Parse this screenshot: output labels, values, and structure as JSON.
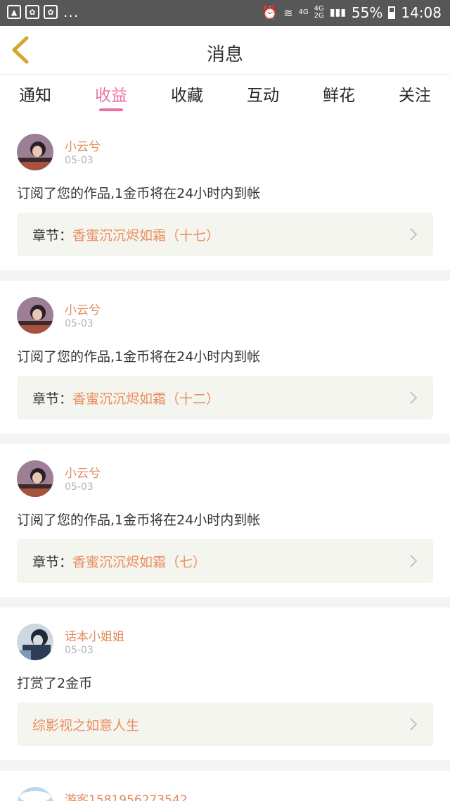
{
  "status_bar": {
    "dots": "...",
    "network_a": "4G",
    "network_b": "4G",
    "network_c": "2G",
    "battery": "55%",
    "time": "14:08"
  },
  "header": {
    "title": "消息"
  },
  "tabs": [
    {
      "label": "通知",
      "active": false
    },
    {
      "label": "收益",
      "active": true
    },
    {
      "label": "收藏",
      "active": false
    },
    {
      "label": "互动",
      "active": false
    },
    {
      "label": "鲜花",
      "active": false
    },
    {
      "label": "关注",
      "active": false
    }
  ],
  "messages": [
    {
      "user": "小云兮",
      "date": "05-03",
      "text": "订阅了您的作品,1金币将在24小时内到帐",
      "chapter_label": "章节：",
      "chapter_title": "香蜜沉沉烬如霜（十七）"
    },
    {
      "user": "小云兮",
      "date": "05-03",
      "text": "订阅了您的作品,1金币将在24小时内到帐",
      "chapter_label": "章节：",
      "chapter_title": "香蜜沉沉烬如霜（十二）"
    },
    {
      "user": "小云兮",
      "date": "05-03",
      "text": "订阅了您的作品,1金币将在24小时内到帐",
      "chapter_label": "章节：",
      "chapter_title": "香蜜沉沉烬如霜（七）"
    },
    {
      "user": "话本小姐姐",
      "date": "05-03",
      "text": "打赏了2金币",
      "chapter_label": "",
      "chapter_title": "综影视之如意人生"
    },
    {
      "user": "游客1581956273542"
    }
  ],
  "colors": {
    "accent_pink": "#ec6fa5",
    "accent_orange": "#e28b5e",
    "back_arrow": "#d3a82d",
    "chapter_bg": "#f4f5ee"
  }
}
